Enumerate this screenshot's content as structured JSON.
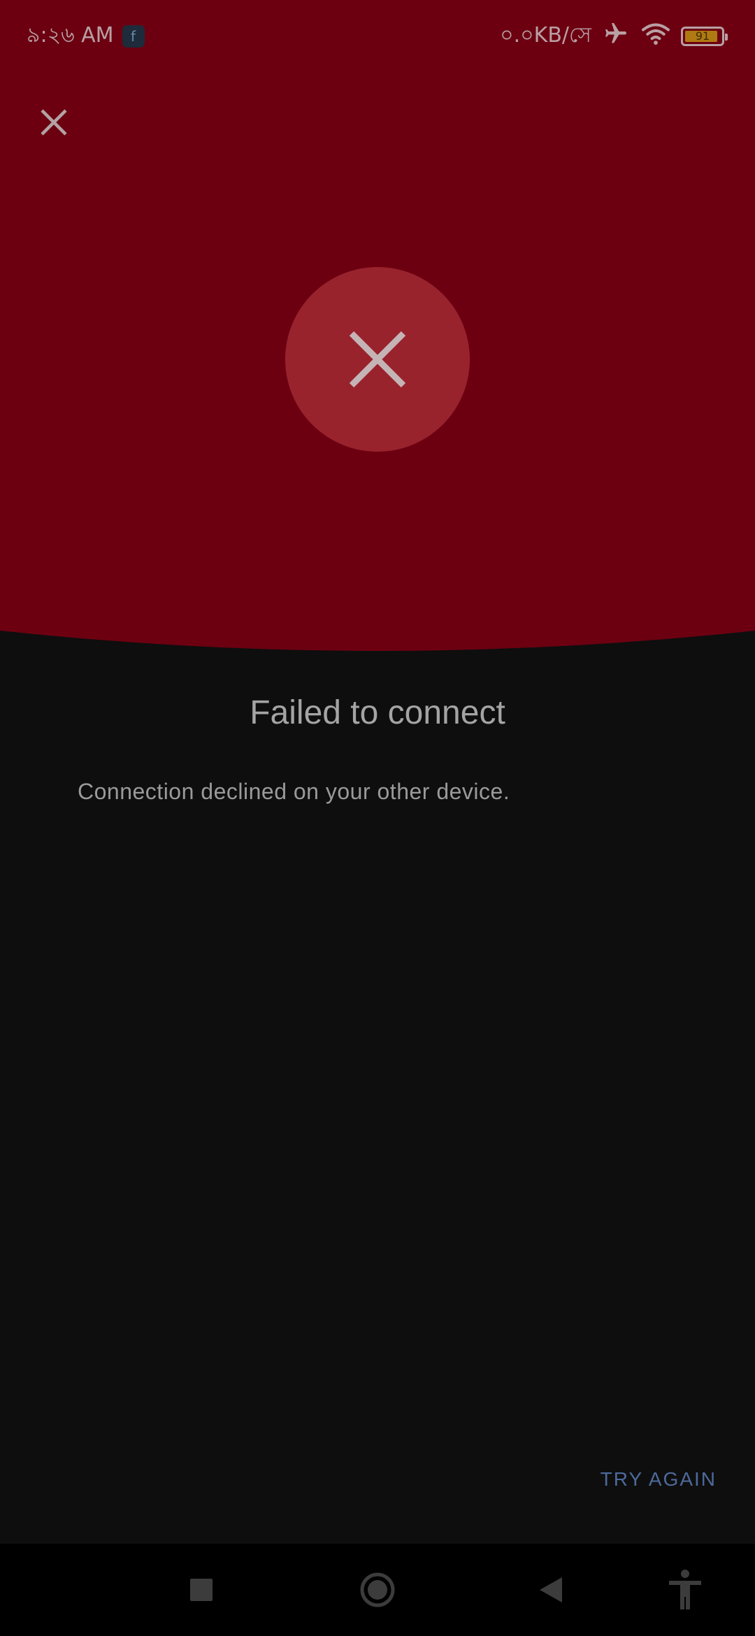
{
  "status_bar": {
    "time": "৯:২৬ AM",
    "app_badge_glyph": "f",
    "net_speed": "০.০KB/সে",
    "battery_level": "91",
    "battery_percent": 91
  },
  "dialog": {
    "title": "Failed to connect",
    "message": "Connection declined on your other device.",
    "try_again_label": "TRY AGAIN"
  },
  "colors": {
    "hero_red": "#6c0011",
    "circle_red": "#99232d",
    "background": "#0e0e0e",
    "accent_blue": "#4d6a9c"
  },
  "icons": {
    "close": "close-icon",
    "fail": "x-icon",
    "airplane": "airplane-mode-icon",
    "wifi": "wifi-icon",
    "battery": "battery-icon",
    "nav_recents": "square-icon",
    "nav_home": "circle-icon",
    "nav_back": "triangle-back-icon",
    "accessibility": "accessibility-icon"
  }
}
